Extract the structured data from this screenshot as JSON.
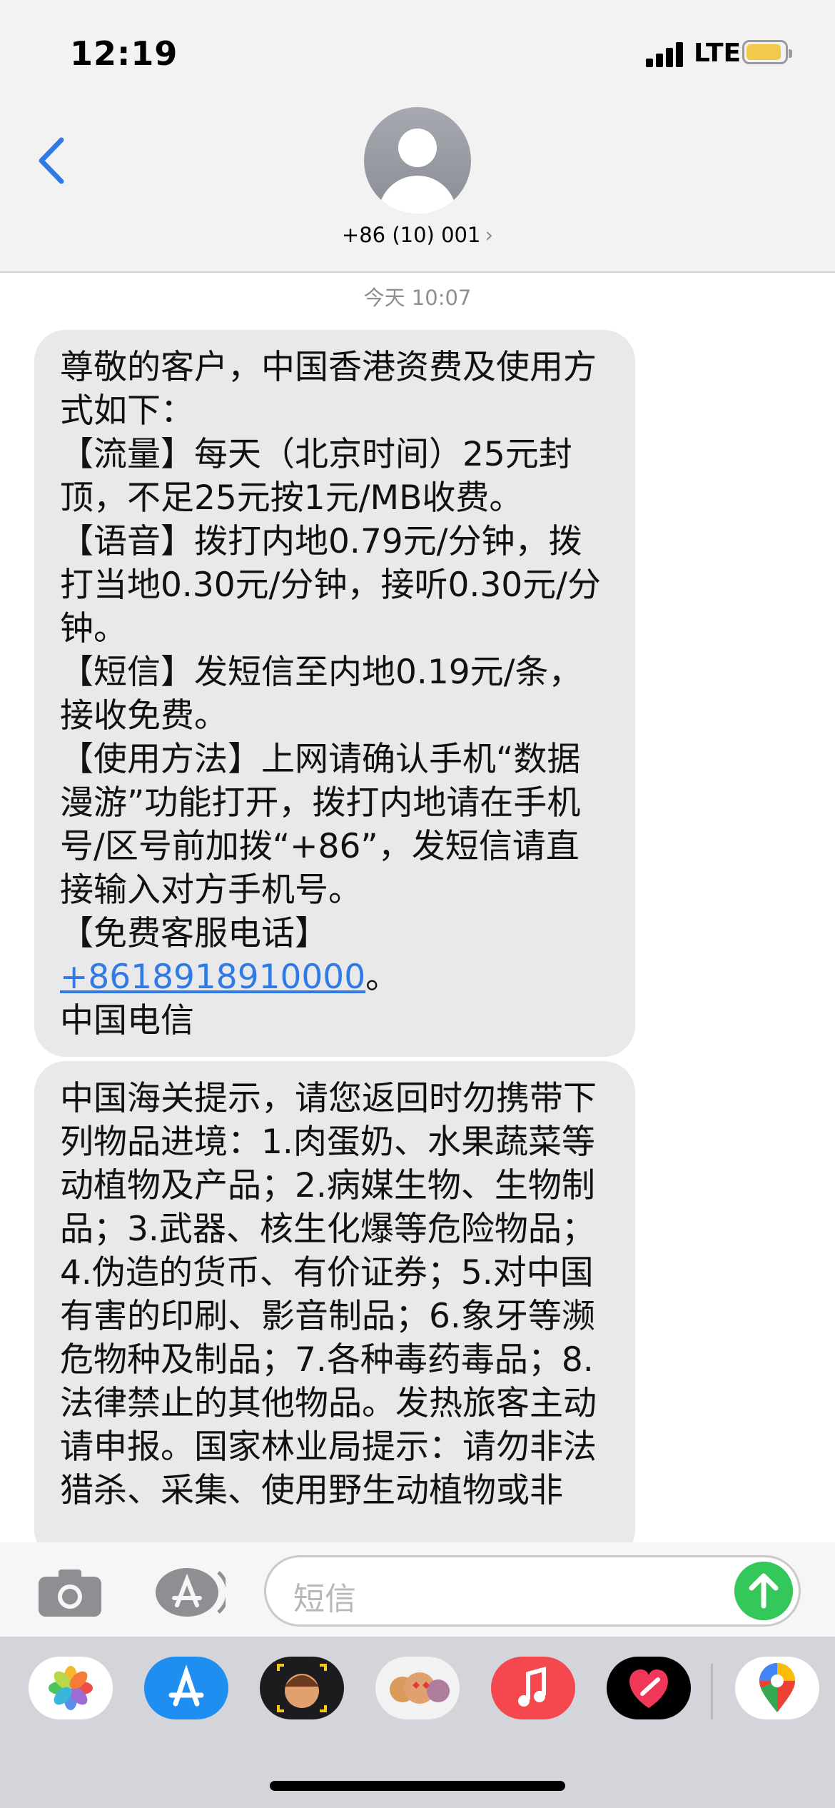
{
  "status_bar": {
    "time": "12:19",
    "network": "LTE"
  },
  "header": {
    "contact_name": "+86 (10) 001",
    "chevron": "›"
  },
  "conversation": {
    "timestamp": "今天 10:07",
    "messages": [
      {
        "part1": "尊敬的客户，中国香港资费及使用方式如下：\n【流量】每天（北京时间）25元封顶，不足25元按1元/MB收费。\n【语音】拨打内地0.79元/分钟，拨打当地0.30元/分钟，接听0.30元/分钟。\n【短信】发短信至内地0.19元/条，接收免费。\n【使用方法】上网请确认手机“数据漫游”功能打开，拨打内地请在手机号/区号前加拨“+86”，发短信请直接输入对方手机号。\n【免费客服电话】\n",
        "phone_link": "+8618918910000",
        "part2": "。\n中国电信"
      },
      {
        "text": "中国海关提示，请您返回时勿携带下列物品进境：1.肉蛋奶、水果蔬菜等动植物及产品；2.病媒生物、生物制品；3.武器、核生化爆等危险物品；4.伪造的货币、有价证券；5.对中国有害的印刷、影音制品；6.象牙等濒危物种及制品；7.各种毒药毒品；8.法律禁止的其他物品。发热旅客主动请申报。国家林业局提示：请勿非法猎杀、采集、使用野生动植物或非"
      }
    ]
  },
  "input_bar": {
    "placeholder": "短信"
  },
  "icons": {
    "back": "chevron-left-icon",
    "camera": "camera-icon",
    "apps": "app-store-icon",
    "send": "arrow-up-icon"
  },
  "app_drawer": [
    "photos",
    "app-store",
    "memoji",
    "memoji-stickers",
    "music",
    "digital-touch",
    "maps"
  ],
  "colors": {
    "accent": "#2f7ae5",
    "bubble": "#e9e9eb",
    "send": "#34c759",
    "battery": "#f2c94c"
  }
}
